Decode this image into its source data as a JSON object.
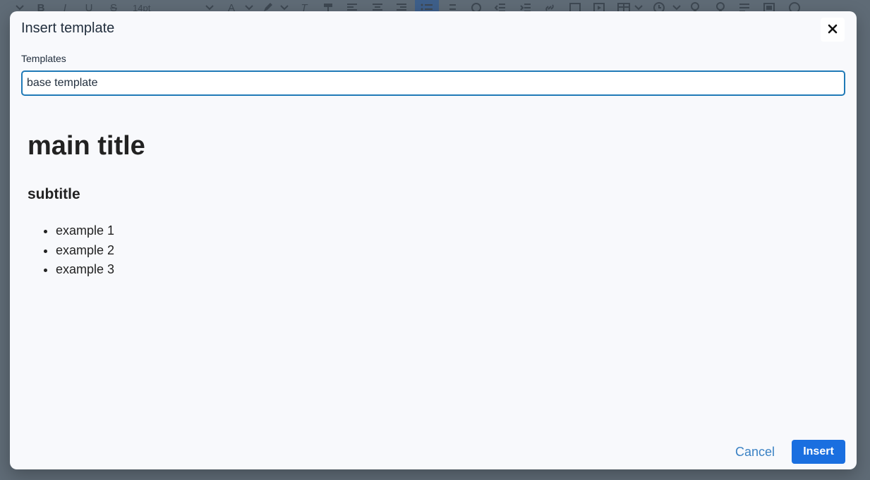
{
  "toolbar": {
    "font_size_value": "14pt",
    "items": [
      "chevron-down-icon",
      "bold-icon",
      "italic-icon",
      "underline-icon",
      "strikethrough-icon"
    ]
  },
  "dialog": {
    "title": "Insert template",
    "templates_label": "Templates",
    "selected_template": "base template",
    "preview": {
      "heading": "main title",
      "subheading": "subtitle",
      "list_items": [
        "example 1",
        "example 2",
        "example 3"
      ]
    },
    "cancel_label": "Cancel",
    "insert_label": "Insert"
  },
  "colors": {
    "accent": "#1a6fe0",
    "focus_border": "#207ab7",
    "overlay": "#5f6b76"
  }
}
